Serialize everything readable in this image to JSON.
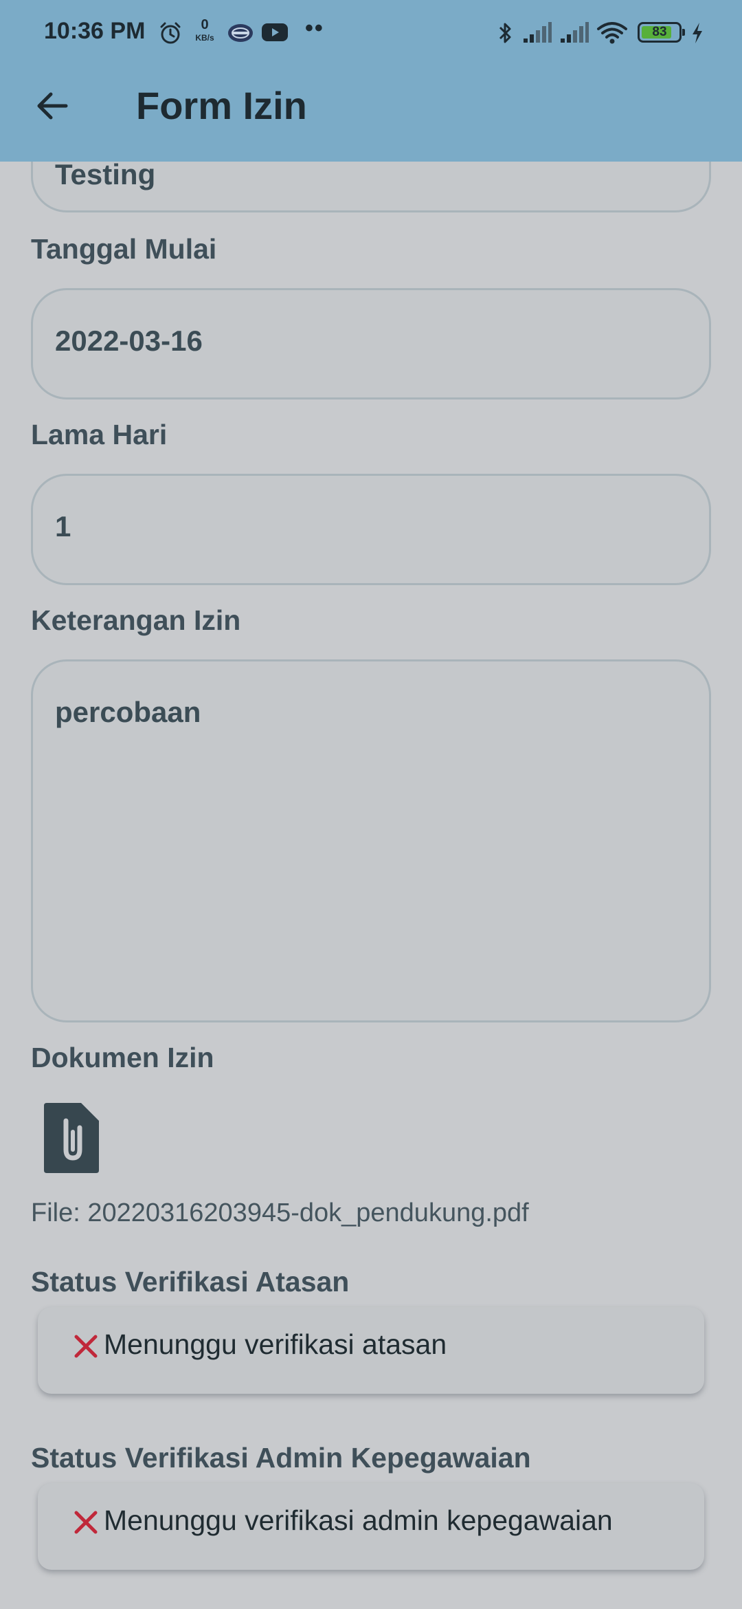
{
  "status_bar": {
    "time": "10:36 PM",
    "net_speed_value": "0",
    "net_speed_unit": "KB/s",
    "dots": "••",
    "battery_level": 83,
    "battery_text": "83"
  },
  "app_bar": {
    "title": "Form Izin"
  },
  "form": {
    "previous_field_value": "Testing",
    "tanggal_mulai_label": "Tanggal Mulai",
    "tanggal_mulai_value": "2022-03-16",
    "lama_hari_label": "Lama Hari",
    "lama_hari_value": "1",
    "keterangan_label": "Keterangan Izin",
    "keterangan_value": "percobaan",
    "dokumen_label": "Dokumen Izin",
    "file_text": "File: 20220316203945-dok_pendukung.pdf",
    "status_atasan_label": "Status Verifikasi Atasan",
    "status_atasan_text": "Menunggu verifikasi atasan",
    "status_admin_label": "Status Verifikasi Admin Kepegawaian",
    "status_admin_text": "Menunggu verifikasi admin kepegawaian"
  },
  "colors": {
    "app_bar": "#7babc7",
    "background": "#c8cacd",
    "status_x": "#c0283a"
  }
}
